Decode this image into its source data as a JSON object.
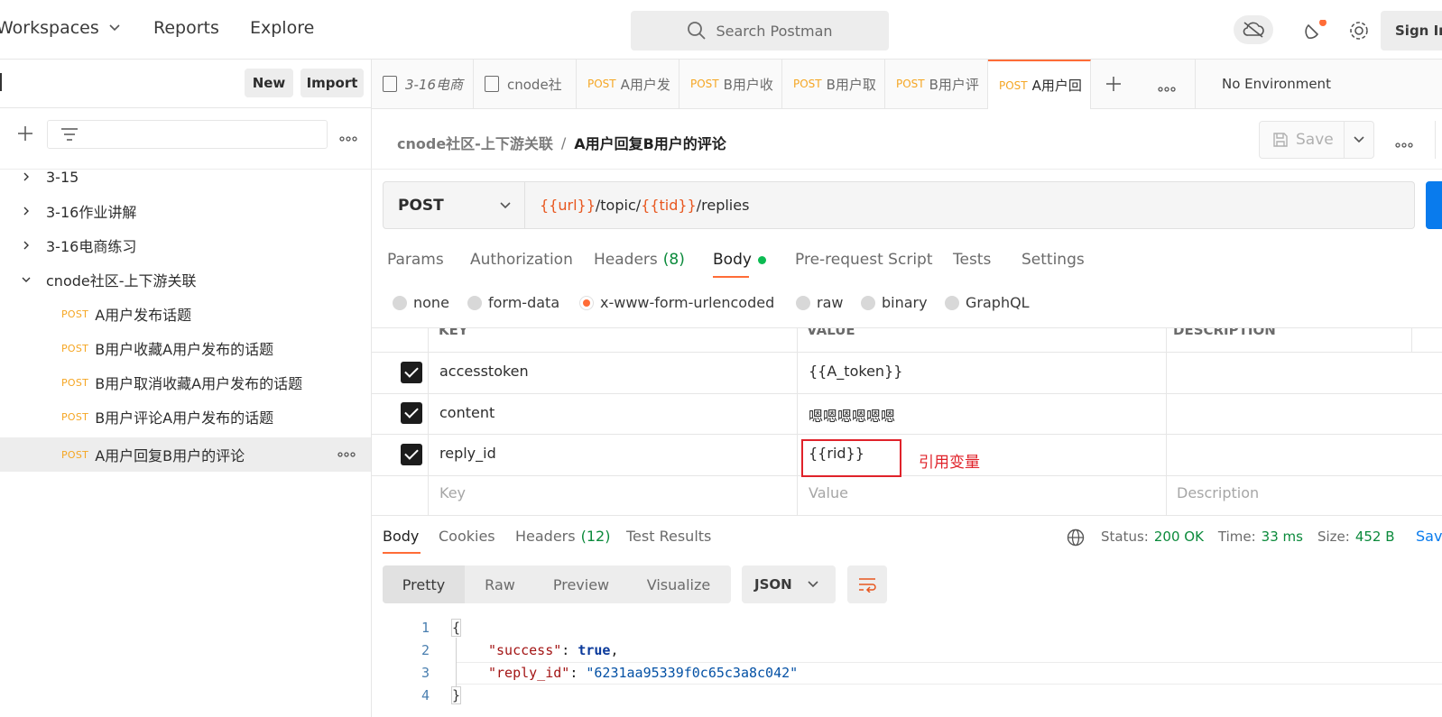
{
  "header": {
    "workspaces": "Workspaces",
    "reports": "Reports",
    "explore": "Explore",
    "search_placeholder": "Search Postman",
    "sign_in": "Sign In"
  },
  "sidebar": {
    "new_btn": "New",
    "import_btn": "Import",
    "folders": [
      {
        "label": "3-15"
      },
      {
        "label": "3-16作业讲解"
      },
      {
        "label": "3-16电商练习"
      },
      {
        "label": "cnode社区-上下游关联"
      }
    ],
    "requests": [
      {
        "method": "POST",
        "label": "A用户发布话题"
      },
      {
        "method": "POST",
        "label": "B用户收藏A用户发布的话题"
      },
      {
        "method": "POST",
        "label": "B用户取消收藏A用户发布的话题"
      },
      {
        "method": "POST",
        "label": "B用户评论A用户发布的话题"
      },
      {
        "method": "POST",
        "label": "A用户回复B用户的评论"
      }
    ]
  },
  "tabs": [
    {
      "method": "",
      "label": "3-16电商"
    },
    {
      "method": "",
      "label": "cnode社"
    },
    {
      "method": "POST",
      "label": "A用户发"
    },
    {
      "method": "POST",
      "label": "B用户收"
    },
    {
      "method": "POST",
      "label": "B用户取"
    },
    {
      "method": "POST",
      "label": "B用户评"
    },
    {
      "method": "POST",
      "label": "A用户回"
    }
  ],
  "environment": "No Environment",
  "request": {
    "breadcrumb_parent": "cnode社区-上下游关联",
    "breadcrumb_sep": "/",
    "title": "A用户回复B用户的评论",
    "save": "Save",
    "method": "POST",
    "url_parts": [
      "{{url}}",
      "/topic/",
      "{{tid}}",
      "/replies"
    ],
    "tabs": {
      "params": "Params",
      "authorization": "Authorization",
      "headers": "Headers",
      "headers_count": "(8)",
      "body": "Body",
      "prerequest": "Pre-request Script",
      "tests": "Tests",
      "settings": "Settings"
    },
    "body_types": [
      "none",
      "form-data",
      "x-www-form-urlencoded",
      "raw",
      "binary",
      "GraphQL"
    ],
    "table_headers": [
      "KEY",
      "VALUE",
      "DESCRIPTION"
    ],
    "rows": [
      {
        "key": "accesstoken",
        "value": "{{A_token}}"
      },
      {
        "key": "content",
        "value": "嗯嗯嗯嗯嗯嗯"
      },
      {
        "key": "reply_id",
        "value": "{{rid}}"
      }
    ],
    "placeholders": {
      "key": "Key",
      "value": "Value",
      "description": "Description"
    },
    "annotation": "引用变量"
  },
  "response": {
    "tabs": {
      "body": "Body",
      "cookies": "Cookies",
      "headers": "Headers",
      "headers_count": "(12)",
      "test_results": "Test Results"
    },
    "status_label": "Status:",
    "status": "200 OK",
    "time_label": "Time:",
    "time": "33 ms",
    "size_label": "Size:",
    "size": "452 B",
    "save": "Save",
    "views": [
      "Pretty",
      "Raw",
      "Preview",
      "Visualize"
    ],
    "format": "JSON",
    "code": {
      "line_numbers": [
        "1",
        "2",
        "3",
        "4"
      ],
      "open": "{",
      "close": "}",
      "k1": "\"success\"",
      "v1": "true",
      "k2": "\"reply_id\"",
      "v2": "\"6231aa95339f0c65c3a8c042\""
    }
  },
  "colors": {
    "accent": "#ff6c37",
    "post": "#f5a623",
    "variable": "#e8571f",
    "status_ok": "#0b8a3b",
    "primary": "#097bed",
    "annotation": "#e0222a"
  }
}
